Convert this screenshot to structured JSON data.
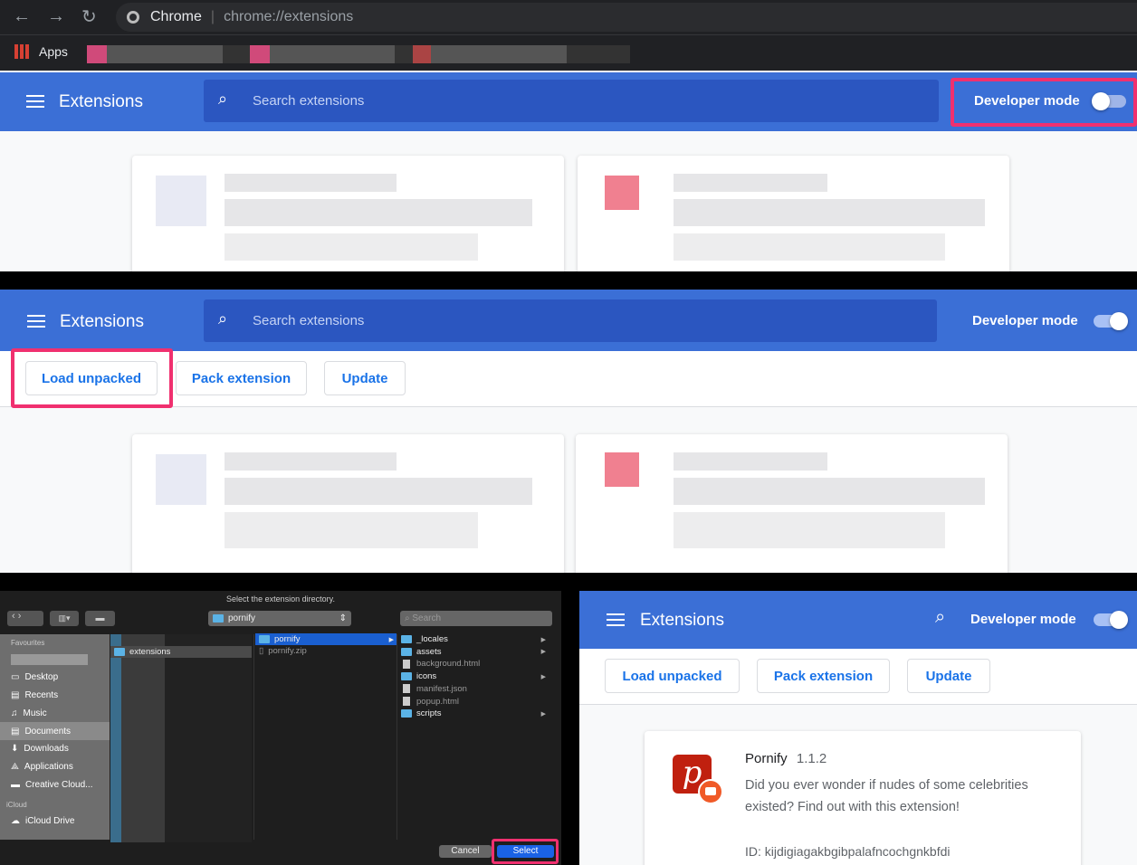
{
  "browser": {
    "tab_name": "Chrome",
    "url": "chrome://extensions",
    "bookmarks_apps": "Apps"
  },
  "extensions_page": {
    "title": "Extensions",
    "search_placeholder": "Search extensions",
    "developer_mode_label": "Developer mode",
    "developer_mode_off": false,
    "developer_mode_on": true,
    "buttons": {
      "load_unpacked": "Load unpacked",
      "pack_extension": "Pack extension",
      "update": "Update"
    }
  },
  "file_dialog": {
    "title": "Select the extension directory.",
    "location": "pornify",
    "search_placeholder": "Search",
    "sidebar": {
      "favourites_label": "Favourites",
      "items": [
        "Desktop",
        "Recents",
        "Music",
        "Documents",
        "Downloads",
        "Applications",
        "Creative Cloud..."
      ],
      "icloud_label": "iCloud",
      "icloud_items": [
        "iCloud Drive"
      ]
    },
    "column1": [
      "extensions"
    ],
    "column2": [
      "pornify",
      "pornify.zip"
    ],
    "column3": [
      {
        "name": "_locales",
        "type": "folder"
      },
      {
        "name": "assets",
        "type": "folder"
      },
      {
        "name": "background.html",
        "type": "file"
      },
      {
        "name": "icons",
        "type": "folder"
      },
      {
        "name": "manifest.json",
        "type": "file"
      },
      {
        "name": "popup.html",
        "type": "file"
      },
      {
        "name": "scripts",
        "type": "folder"
      }
    ],
    "cancel": "Cancel",
    "select": "Select"
  },
  "extension_card": {
    "name": "Pornify",
    "version": "1.1.2",
    "description": "Did you ever wonder if nudes of some celebrities existed? Find out with this extension!",
    "id": "ID: kijdigiagakbgibpalafncochgnkbfdi"
  },
  "colors": {
    "header": "#3b6fd6",
    "highlight": "#f0306f",
    "accent": "#1a73e8"
  }
}
